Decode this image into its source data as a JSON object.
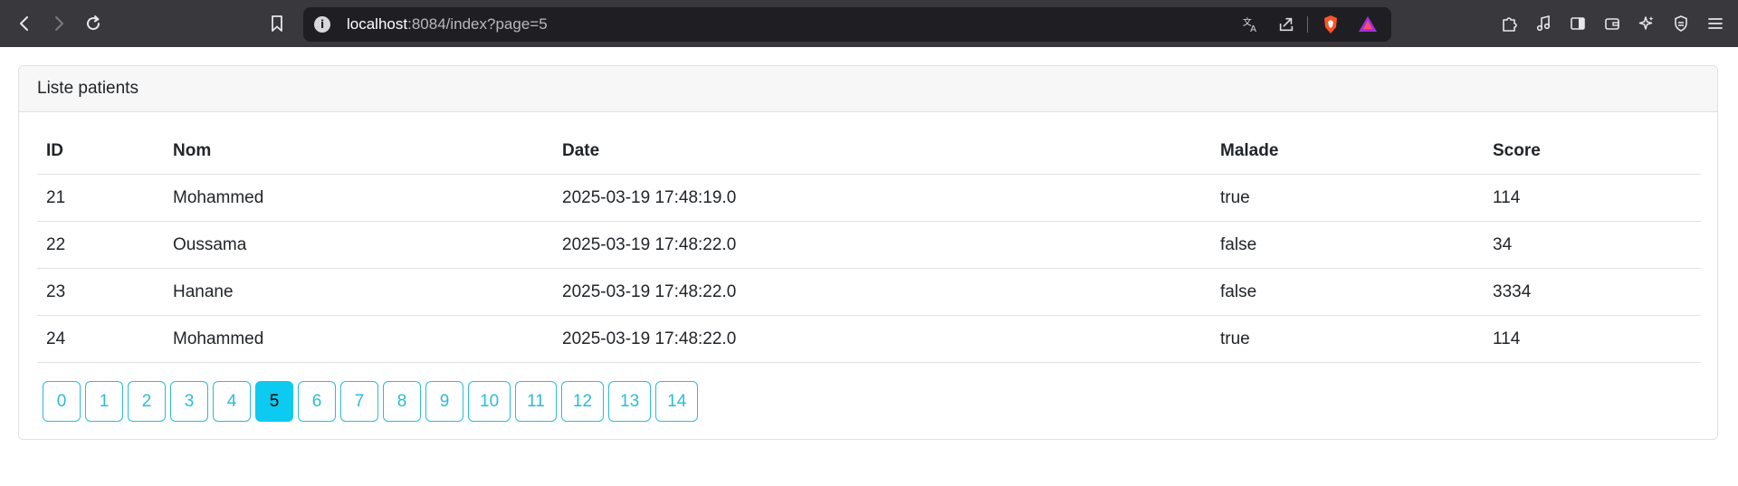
{
  "browser": {
    "url_host": "localhost",
    "url_rest": ":8084/index?page=5"
  },
  "card": {
    "header": "Liste patients"
  },
  "table": {
    "columns": [
      "ID",
      "Nom",
      "Date",
      "Malade",
      "Score"
    ],
    "rows": [
      [
        "21",
        "Mohammed",
        "2025-03-19 17:48:19.0",
        "true",
        "114"
      ],
      [
        "22",
        "Oussama",
        "2025-03-19 17:48:22.0",
        "false",
        "34"
      ],
      [
        "23",
        "Hanane",
        "2025-03-19 17:48:22.0",
        "false",
        "3334"
      ],
      [
        "24",
        "Mohammed",
        "2025-03-19 17:48:22.0",
        "true",
        "114"
      ]
    ]
  },
  "pagination": {
    "pages": [
      "0",
      "1",
      "2",
      "3",
      "4",
      "5",
      "6",
      "7",
      "8",
      "9",
      "10",
      "11",
      "12",
      "13",
      "14"
    ],
    "current": "5"
  },
  "colors": {
    "accent": "#0dcaf0",
    "page_border": "#2bbcd6",
    "toolbar": "#38383d"
  }
}
